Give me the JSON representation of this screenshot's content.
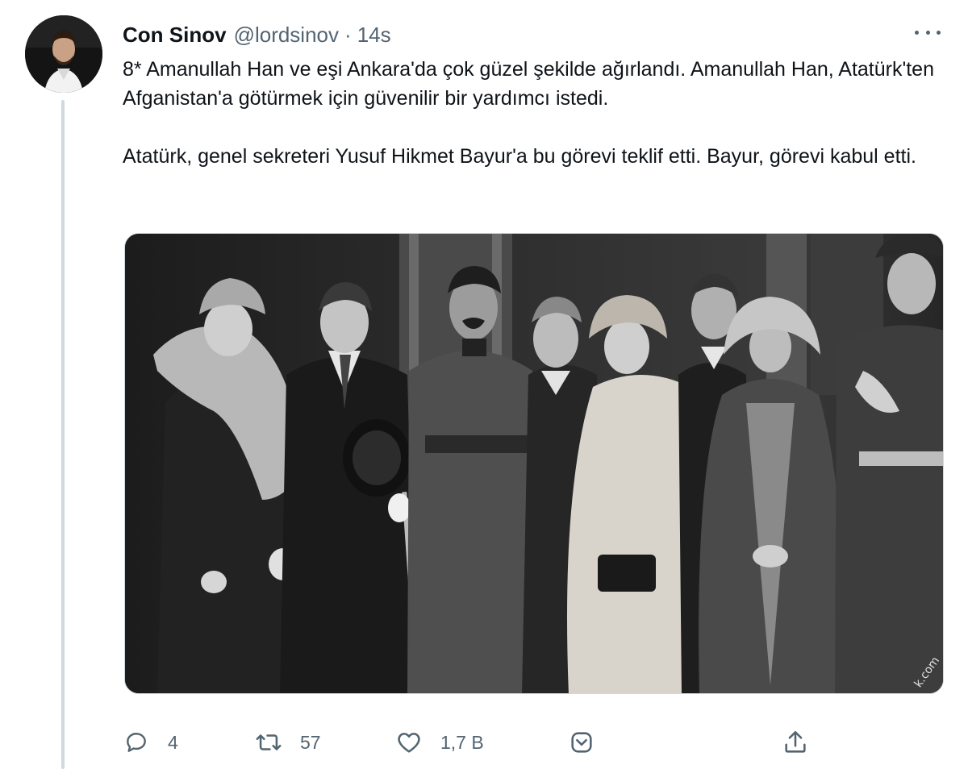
{
  "tweet": {
    "display_name": "Con Sinov",
    "handle": "@lordsinov",
    "separator": "·",
    "timestamp": "14s",
    "paragraphs": [
      "8* Amanullah Han ve eşi Ankara'da çok güzel şekilde ağırlandı. Amanullah Han, Atatürk'ten Afganistan'a götürmek için güvenilir bir yardımcı istedi.",
      "Atatürk, genel sekreteri Yusuf Hikmet Bayur'a bu görevi teklif etti. Bayur, görevi kabul etti."
    ]
  },
  "actions": {
    "reply_count": "4",
    "retweet_count": "57",
    "like_count": "1,7 B"
  },
  "icons": {
    "more": "more-dots-icon",
    "reply": "reply-bubble-icon",
    "retweet": "retweet-arrows-icon",
    "like": "heart-icon",
    "tip": "tip-jar-icon",
    "share": "share-upload-icon"
  },
  "media": {
    "watermark": "k.com"
  },
  "colors": {
    "text": "#0f1419",
    "secondary": "#536471",
    "thread_line": "#cfd9de"
  }
}
